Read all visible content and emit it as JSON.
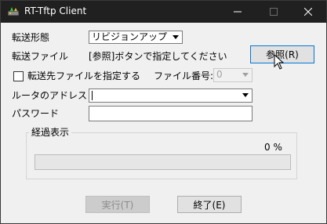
{
  "window": {
    "title": "RT-Tftp Client",
    "controls": [
      "minimize-icon",
      "maximize-icon",
      "close-icon"
    ]
  },
  "form": {
    "transfer_mode_label": "転送形態",
    "transfer_mode_value": "リビジョンアップ",
    "transfer_file_label": "転送ファイル",
    "transfer_file_hint": "[参照]ボタンで指定してください",
    "browse_button": "参照(R)",
    "specify_dest_checkbox": "転送先ファイルを指定する",
    "specify_dest_checked": false,
    "file_number_label": "ファイル番号:",
    "file_number_value": "0",
    "router_address_label": "ルータのアドレス",
    "router_address_value": "",
    "password_label": "パスワード",
    "password_value": ""
  },
  "progress": {
    "group_label": "経過表示",
    "percent_text": "0 %",
    "value": 0
  },
  "footer": {
    "run_button": "実行(T)",
    "exit_button": "終了(E)"
  },
  "colors": {
    "titlebar": "#202020",
    "window_bg": "#f0f0f0",
    "focus_border": "#0078d7",
    "progress_fill": "#06b025"
  }
}
